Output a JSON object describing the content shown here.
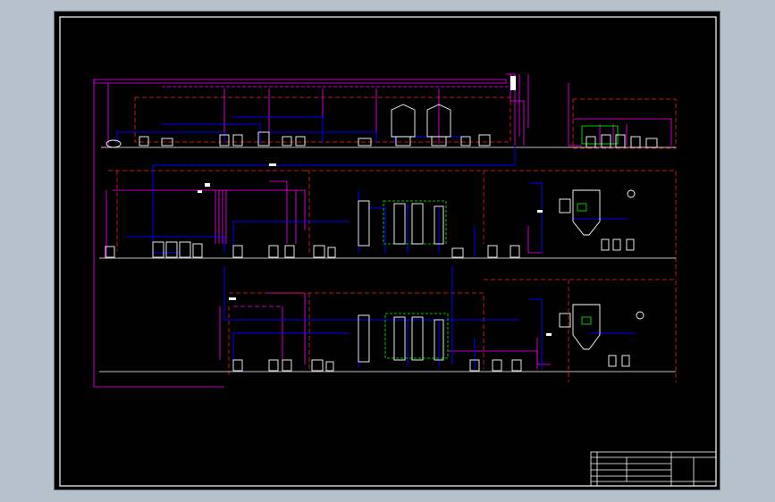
{
  "drawing": {
    "title_block": {
      "company_line": "",
      "title": "",
      "subtitle": "",
      "drawing_no": ""
    }
  },
  "colors": {
    "background": "#000000",
    "border": "#ffffff",
    "process_line": "#0000ff",
    "signal_line": "#ff00ff",
    "dashed_frame": "#ff2020",
    "equipment": "#ffffff",
    "highlight": "#00ff00"
  }
}
